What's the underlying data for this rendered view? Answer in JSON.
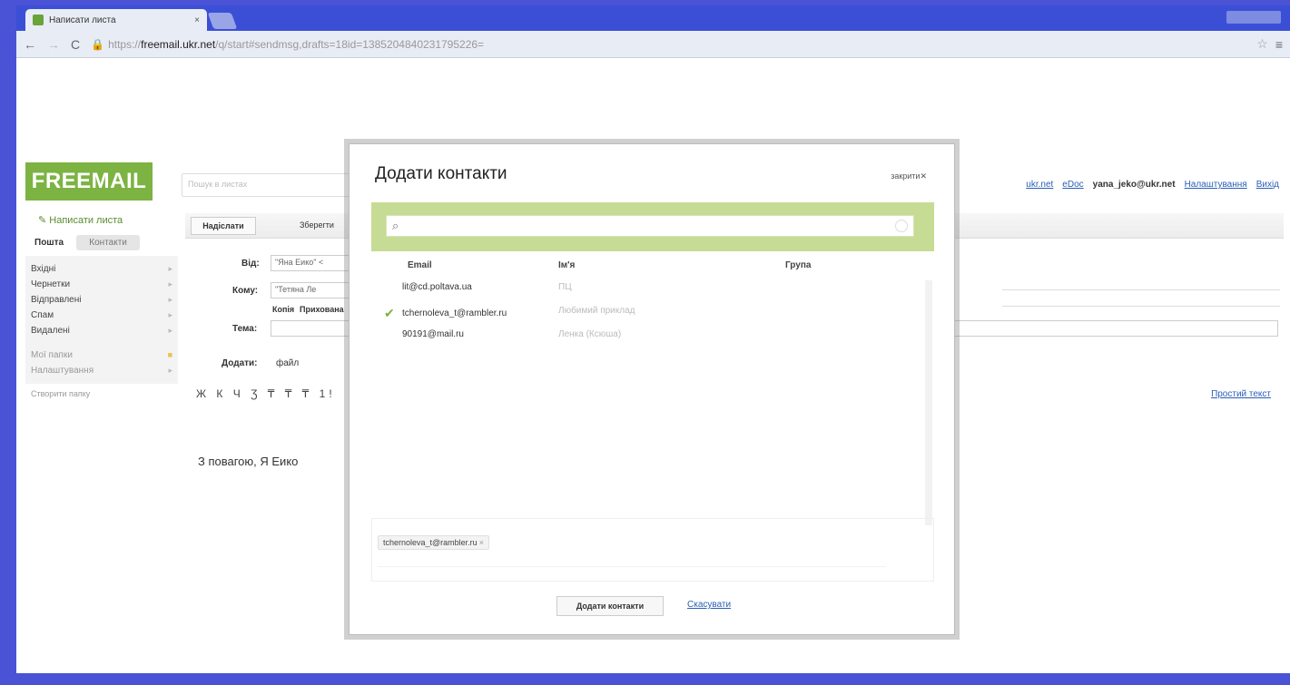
{
  "browser": {
    "tab_title": "Написати листа",
    "tab_close": "×",
    "url_scheme": "https://",
    "url_domain": "freemail.ukr.net",
    "url_path": "/q/start#sendmsg,drafts=18id=1385204840231795226=",
    "nav_icons": {
      "back": "arrow-left-icon",
      "forward": "arrow-right-icon",
      "reload": "reload-icon",
      "lock": "lock-icon",
      "star": "star-icon",
      "menu": "menu-icon"
    }
  },
  "header": {
    "logo": "FREEMAIL",
    "search_placeholder": "Пошук в листах",
    "links": [
      "ukr.net",
      "eDoc"
    ],
    "user": "yana_jeko@ukr.net",
    "settings": "Налаштування",
    "logout": "Вихід"
  },
  "sidebar": {
    "compose": "Написати листа",
    "tab_mail": "Пошта",
    "tab_contacts": "Контакти",
    "folders": [
      {
        "name": "Вхідні",
        "count": ""
      },
      {
        "name": "Чернетки",
        "count": ""
      },
      {
        "name": "Відправлені",
        "count": ""
      },
      {
        "name": "Спам",
        "count": ""
      },
      {
        "name": "Видалені",
        "count": ""
      }
    ],
    "extra_folders": [
      {
        "name": "Мої папки",
        "count": ""
      },
      {
        "name": "Налаштування",
        "count": ""
      }
    ],
    "footer": "Створити папку"
  },
  "compose": {
    "send_label": "Надіслати",
    "save_label": "Зберегти",
    "from_label": "Від:",
    "from_value": "\"Яна Еико\" <",
    "to_label": "Кому:",
    "to_value": "\"Тетяна Ле",
    "copy_label": "Копія",
    "bcc_label": "Прихована",
    "subject_label": "Тема:",
    "attach_label": "Додати:",
    "attach_file": "файл",
    "format_tools": "Ж К Ч Ʒ ₸ ₸ ₸ 1!",
    "plain_text": "Простий текст",
    "signature": "З повагою, Я Еико"
  },
  "modal": {
    "title": "Додати контакти",
    "close_label": "закрити",
    "search_placeholder": "",
    "columns": {
      "email": "Email",
      "name": "Ім'я",
      "group": "Група"
    },
    "contacts": [
      {
        "email": "lit@cd.poltava.ua",
        "name": "ПЦ",
        "checked": false
      },
      {
        "email": "tchernoleva_t@rambler.ru",
        "name": "Любимий приклад",
        "checked": true
      },
      {
        "email": "90191@mail.ru",
        "name": "Ленка (Ксюша)",
        "checked": false
      }
    ],
    "selected_chip": "tchernoleva_t@rambler.ru",
    "add_button": "Додати контакти",
    "cancel_link": "Скасувати"
  }
}
